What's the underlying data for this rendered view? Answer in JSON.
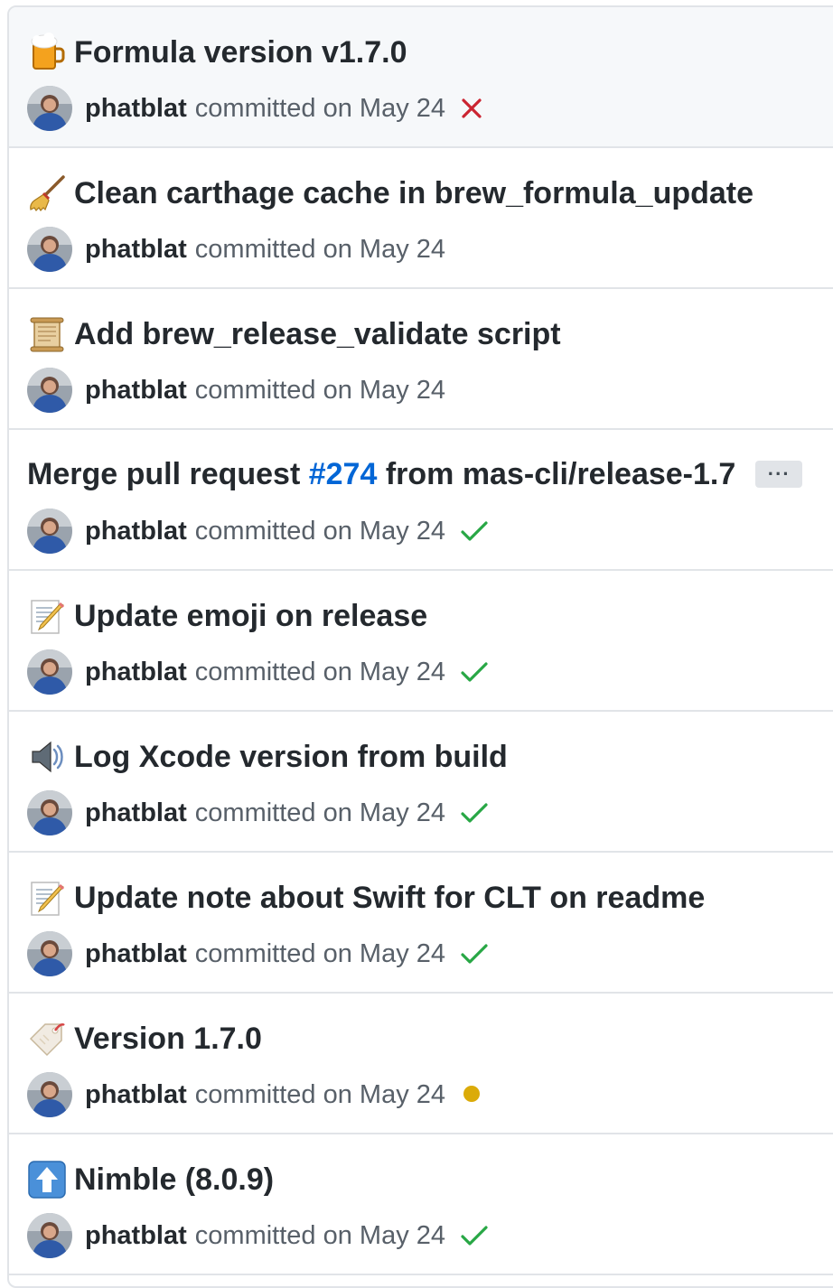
{
  "commits": [
    {
      "emoji": "beer-mug",
      "title": "Formula version v1.7.0",
      "author": "phatblat",
      "committed_text": "committed on May 24",
      "status": "failure",
      "highlighted": true
    },
    {
      "emoji": "broom",
      "title": "Clean carthage cache in brew_formula_update",
      "author": "phatblat",
      "committed_text": "committed on May 24",
      "status": "none"
    },
    {
      "emoji": "scroll",
      "title": "Add brew_release_validate script",
      "author": "phatblat",
      "committed_text": "committed on May 24",
      "status": "none"
    },
    {
      "emoji": "none",
      "title_prefix": "Merge pull request ",
      "issue_link": "#274",
      "title_suffix": " from mas-cli/release-1.7",
      "ellipsis": "···",
      "author": "phatblat",
      "committed_text": "committed on May 24",
      "status": "success"
    },
    {
      "emoji": "memo",
      "title": "Update emoji on release",
      "author": "phatblat",
      "committed_text": "committed on May 24",
      "status": "success"
    },
    {
      "emoji": "speaker",
      "title": "Log Xcode version from build",
      "author": "phatblat",
      "committed_text": "committed on May 24",
      "status": "success"
    },
    {
      "emoji": "memo",
      "title": "Update note about Swift for CLT on readme",
      "author": "phatblat",
      "committed_text": "committed on May 24",
      "status": "success"
    },
    {
      "emoji": "label-tag",
      "title": "Version 1.7.0",
      "author": "phatblat",
      "committed_text": "committed on May 24",
      "status": "pending"
    },
    {
      "emoji": "arrow-up",
      "title": "Nimble (8.0.9)",
      "author": "phatblat",
      "committed_text": "committed on May 24",
      "status": "success"
    }
  ],
  "colors": {
    "failure": "#cb2431",
    "success": "#28a745",
    "pending": "#dbab09",
    "link": "#0366d6"
  }
}
